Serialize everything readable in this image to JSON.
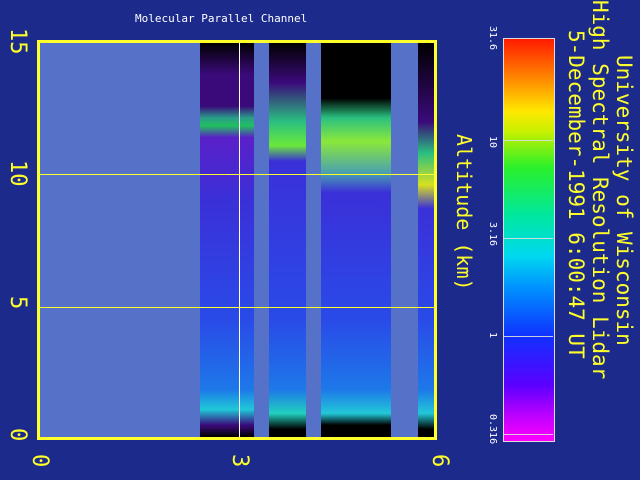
{
  "title": "Molecular Parallel Channel",
  "axis": {
    "y_label": "Altitude (km)",
    "y_ticks": [
      "15",
      "10",
      "5",
      "0"
    ],
    "x_ticks": [
      "0",
      "3",
      "6"
    ]
  },
  "colorbar": {
    "ticks": [
      "31.6",
      "10",
      "3.16",
      "1",
      "0.316"
    ]
  },
  "header": {
    "line1": "University of Wisconsin",
    "line2": "High Spectral Resolution Lidar",
    "line3": "5-December-1991  6:00:47 UT"
  },
  "colors": {
    "background": "#1c2a8c",
    "frame": "#ffff2a",
    "no_data": "#5672c8"
  }
}
